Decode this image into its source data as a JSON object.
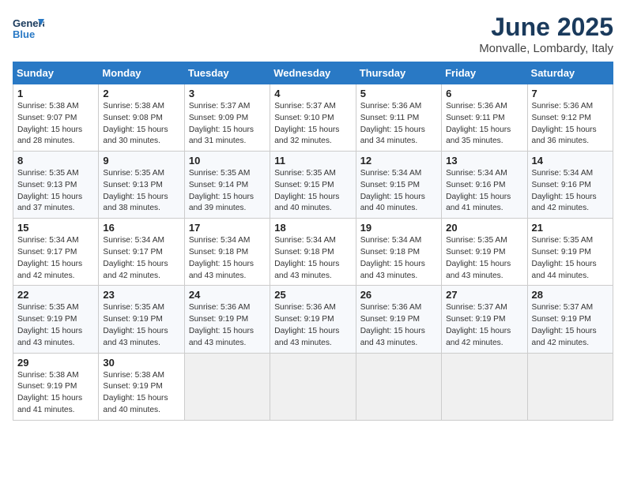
{
  "header": {
    "logo": {
      "general": "General",
      "blue": "Blue"
    },
    "month": "June 2025",
    "location": "Monvalle, Lombardy, Italy"
  },
  "weekdays": [
    "Sunday",
    "Monday",
    "Tuesday",
    "Wednesday",
    "Thursday",
    "Friday",
    "Saturday"
  ],
  "weeks": [
    [
      {
        "day": "1",
        "lines": [
          "Sunrise: 5:38 AM",
          "Sunset: 9:07 PM",
          "Daylight: 15 hours",
          "and 28 minutes."
        ]
      },
      {
        "day": "2",
        "lines": [
          "Sunrise: 5:38 AM",
          "Sunset: 9:08 PM",
          "Daylight: 15 hours",
          "and 30 minutes."
        ]
      },
      {
        "day": "3",
        "lines": [
          "Sunrise: 5:37 AM",
          "Sunset: 9:09 PM",
          "Daylight: 15 hours",
          "and 31 minutes."
        ]
      },
      {
        "day": "4",
        "lines": [
          "Sunrise: 5:37 AM",
          "Sunset: 9:10 PM",
          "Daylight: 15 hours",
          "and 32 minutes."
        ]
      },
      {
        "day": "5",
        "lines": [
          "Sunrise: 5:36 AM",
          "Sunset: 9:11 PM",
          "Daylight: 15 hours",
          "and 34 minutes."
        ]
      },
      {
        "day": "6",
        "lines": [
          "Sunrise: 5:36 AM",
          "Sunset: 9:11 PM",
          "Daylight: 15 hours",
          "and 35 minutes."
        ]
      },
      {
        "day": "7",
        "lines": [
          "Sunrise: 5:36 AM",
          "Sunset: 9:12 PM",
          "Daylight: 15 hours",
          "and 36 minutes."
        ]
      }
    ],
    [
      {
        "day": "8",
        "lines": [
          "Sunrise: 5:35 AM",
          "Sunset: 9:13 PM",
          "Daylight: 15 hours",
          "and 37 minutes."
        ]
      },
      {
        "day": "9",
        "lines": [
          "Sunrise: 5:35 AM",
          "Sunset: 9:13 PM",
          "Daylight: 15 hours",
          "and 38 minutes."
        ]
      },
      {
        "day": "10",
        "lines": [
          "Sunrise: 5:35 AM",
          "Sunset: 9:14 PM",
          "Daylight: 15 hours",
          "and 39 minutes."
        ]
      },
      {
        "day": "11",
        "lines": [
          "Sunrise: 5:35 AM",
          "Sunset: 9:15 PM",
          "Daylight: 15 hours",
          "and 40 minutes."
        ]
      },
      {
        "day": "12",
        "lines": [
          "Sunrise: 5:34 AM",
          "Sunset: 9:15 PM",
          "Daylight: 15 hours",
          "and 40 minutes."
        ]
      },
      {
        "day": "13",
        "lines": [
          "Sunrise: 5:34 AM",
          "Sunset: 9:16 PM",
          "Daylight: 15 hours",
          "and 41 minutes."
        ]
      },
      {
        "day": "14",
        "lines": [
          "Sunrise: 5:34 AM",
          "Sunset: 9:16 PM",
          "Daylight: 15 hours",
          "and 42 minutes."
        ]
      }
    ],
    [
      {
        "day": "15",
        "lines": [
          "Sunrise: 5:34 AM",
          "Sunset: 9:17 PM",
          "Daylight: 15 hours",
          "and 42 minutes."
        ]
      },
      {
        "day": "16",
        "lines": [
          "Sunrise: 5:34 AM",
          "Sunset: 9:17 PM",
          "Daylight: 15 hours",
          "and 42 minutes."
        ]
      },
      {
        "day": "17",
        "lines": [
          "Sunrise: 5:34 AM",
          "Sunset: 9:18 PM",
          "Daylight: 15 hours",
          "and 43 minutes."
        ]
      },
      {
        "day": "18",
        "lines": [
          "Sunrise: 5:34 AM",
          "Sunset: 9:18 PM",
          "Daylight: 15 hours",
          "and 43 minutes."
        ]
      },
      {
        "day": "19",
        "lines": [
          "Sunrise: 5:34 AM",
          "Sunset: 9:18 PM",
          "Daylight: 15 hours",
          "and 43 minutes."
        ]
      },
      {
        "day": "20",
        "lines": [
          "Sunrise: 5:35 AM",
          "Sunset: 9:19 PM",
          "Daylight: 15 hours",
          "and 43 minutes."
        ]
      },
      {
        "day": "21",
        "lines": [
          "Sunrise: 5:35 AM",
          "Sunset: 9:19 PM",
          "Daylight: 15 hours",
          "and 44 minutes."
        ]
      }
    ],
    [
      {
        "day": "22",
        "lines": [
          "Sunrise: 5:35 AM",
          "Sunset: 9:19 PM",
          "Daylight: 15 hours",
          "and 43 minutes."
        ]
      },
      {
        "day": "23",
        "lines": [
          "Sunrise: 5:35 AM",
          "Sunset: 9:19 PM",
          "Daylight: 15 hours",
          "and 43 minutes."
        ]
      },
      {
        "day": "24",
        "lines": [
          "Sunrise: 5:36 AM",
          "Sunset: 9:19 PM",
          "Daylight: 15 hours",
          "and 43 minutes."
        ]
      },
      {
        "day": "25",
        "lines": [
          "Sunrise: 5:36 AM",
          "Sunset: 9:19 PM",
          "Daylight: 15 hours",
          "and 43 minutes."
        ]
      },
      {
        "day": "26",
        "lines": [
          "Sunrise: 5:36 AM",
          "Sunset: 9:19 PM",
          "Daylight: 15 hours",
          "and 43 minutes."
        ]
      },
      {
        "day": "27",
        "lines": [
          "Sunrise: 5:37 AM",
          "Sunset: 9:19 PM",
          "Daylight: 15 hours",
          "and 42 minutes."
        ]
      },
      {
        "day": "28",
        "lines": [
          "Sunrise: 5:37 AM",
          "Sunset: 9:19 PM",
          "Daylight: 15 hours",
          "and 42 minutes."
        ]
      }
    ],
    [
      {
        "day": "29",
        "lines": [
          "Sunrise: 5:38 AM",
          "Sunset: 9:19 PM",
          "Daylight: 15 hours",
          "and 41 minutes."
        ]
      },
      {
        "day": "30",
        "lines": [
          "Sunrise: 5:38 AM",
          "Sunset: 9:19 PM",
          "Daylight: 15 hours",
          "and 40 minutes."
        ]
      },
      null,
      null,
      null,
      null,
      null
    ]
  ]
}
